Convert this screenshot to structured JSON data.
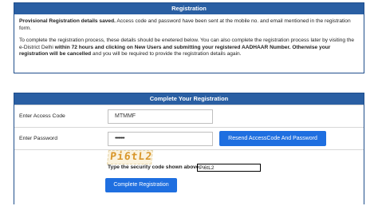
{
  "top_panel": {
    "title": "Registration",
    "msg_bold": "Provisional Registration details saved.",
    "msg_rest": " Access code and password have been sent at the mobile no. and email mentioned in the registration form.",
    "para2_part1": "To complete the registration process, these details should be enetered below. You can also complete the registration process later by visiting the e-District Delhi ",
    "para2_bold1": "within 72 hours and clicking on New Users and submitting your registered AADHAAR Number. Otherwise your registration will be cancelled",
    "para2_part2": " and you will be required to provide the registration details again."
  },
  "form": {
    "title": "Complete Your Registration",
    "access_code_label": "Enter Access Code",
    "access_code_value": "MTMMF",
    "password_label": "Enter Password",
    "password_value": "••••••••",
    "resend_label": "Resend AccessCode And Password",
    "captcha_image_text": "Pi6tL2",
    "captcha_prompt": "Type the security code shown above:",
    "captcha_value": "Pi6tL2",
    "submit_label": "Complete Registration"
  },
  "colors": {
    "header_bg": "#2a5fa3",
    "button_bg": "#1f6fe0"
  }
}
